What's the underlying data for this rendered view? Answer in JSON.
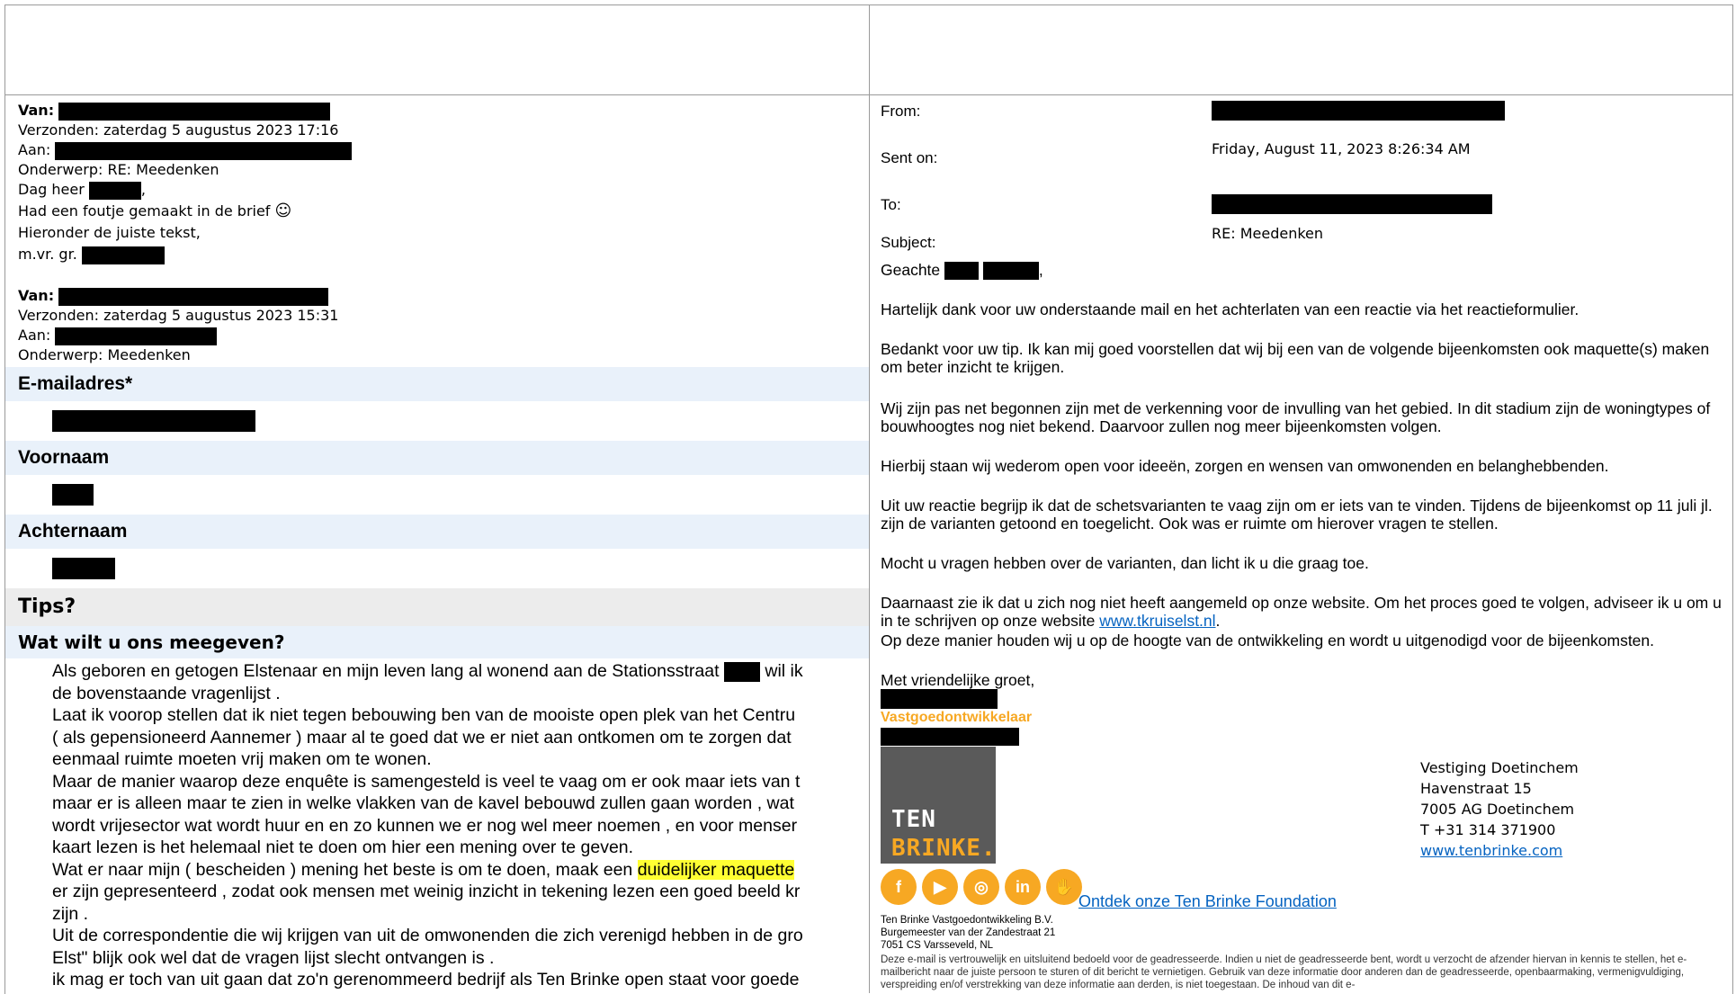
{
  "left": {
    "mail1": {
      "van_label": "Van:",
      "verzonden": "Verzonden: zaterdag 5 augustus 2023 17:16",
      "aan_label": "Aan:",
      "onderwerp": "Onderwerp: RE: Meedenken",
      "greeting": "Dag heer",
      "line1": "Had een foutje gemaakt in de brief",
      "line2": "Hieronder de juiste tekst,",
      "closing": "m.vr. gr."
    },
    "mail2": {
      "van_label": "Van:",
      "verzonden": "Verzonden: zaterdag 5 augustus 2023 15:31",
      "aan_label": "Aan:",
      "onderwerp": "Onderwerp: Meedenken"
    },
    "form": {
      "email_label": "E-mailadres*",
      "firstname_label": "Voornaam",
      "lastname_label": "Achternaam",
      "tips_label": "Tips?",
      "question_label": "Wat wilt u ons meegeven?"
    },
    "comment": {
      "l1a": "Als geboren en getogen Elstenaar en mijn leven lang al wonend aan de Stationsstraat",
      "l1b": "wil ik",
      "l2": "de bovenstaande vragenlijst .",
      "l3": "Laat ik voorop stellen dat ik niet tegen bebouwing ben van de mooiste open plek van het Centru",
      "l4": "( als gepensioneerd Aannemer ) maar al te goed dat we er niet aan ontkomen om te zorgen dat",
      "l5": "eenmaal ruimte moeten vrij maken om te wonen.",
      "l6": "Maar de manier waarop deze enquête is samengesteld is veel te vaag om er ook maar iets van t",
      "l7": "maar er is alleen maar te zien in welke vlakken van de kavel bebouwd zullen gaan worden , wat",
      "l8": "wordt vrijesector wat wordt huur en en zo kunnen we er nog wel meer noemen , en voor menser",
      "l9": "kaart lezen is het helemaal niet te doen om hier een mening over te geven.",
      "l10a": "Wat er naar mijn ( bescheiden ) mening het beste is om te doen, maak een",
      "l10b": "duidelijker maquette",
      "l11": "er zijn gepresenteerd , zodat ook mensen met weinig inzicht in tekening lezen een goed beeld kr",
      "l12": "zijn .",
      "l13": "Uit de correspondentie die wij krijgen van uit de omwonenden die zich verenigd hebben in de gro",
      "l14": "Elst\" blijk ook wel dat de vragen lijst slecht ontvangen is .",
      "l15": "ik mag er toch van uit gaan dat zo'n gerenommeerd bedrijf als Ten Brinke open staat voor goede"
    }
  },
  "right": {
    "from_label": "From:",
    "sent_label": "Sent on:",
    "sent_value": "Friday, August 11, 2023 8:26:34 AM",
    "to_label": "To:",
    "subject_label": "Subject:",
    "subject_value": "RE: Meedenken",
    "salutation": "Geachte",
    "p1": "Hartelijk dank voor uw onderstaande mail en het achterlaten van een reactie via het reactieformulier.",
    "p2": "Bedankt voor uw tip. Ik kan mij goed voorstellen dat wij bij een van de volgende bijeenkomsten ook maquette(s) maken om beter inzicht te krijgen.",
    "p3": "Wij zijn pas net begonnen zijn met de verkenning voor de invulling van het gebied. In dit stadium zijn de woningtypes of bouwhoogtes nog niet bekend. Daarvoor zullen nog meer bijeenkomsten volgen.",
    "p4": "Hierbij staan wij wederom open voor ideeën, zorgen en wensen van omwonenden en belanghebbenden.",
    "p5": "Uit uw reactie begrijp ik dat de schetsvarianten te vaag zijn om er iets van te vinden. Tijdens de bijeenkomst op 11 juli jl. zijn de varianten getoond en toegelicht. Ook was er ruimte om hierover vragen te stellen.",
    "p6": "Mocht u vragen hebben over de varianten, dan licht ik u die graag toe.",
    "p7a": "Daarnaast zie ik dat u zich nog niet heeft aangemeld op onze website. Om het proces goed te volgen, adviseer ik u om u in te schrijven op onze website",
    "p7_link": "www.tkruiselst.nl",
    "p7b": ".",
    "p8": "Op deze manier houden wij u op de hoogte van de ontwikkeling en wordt u uitgenodigd voor de bijeenkomsten.",
    "regards": "Met vriendelijke groet,",
    "role": "Vastgoedontwikkelaar",
    "logo_line1": "TEN",
    "logo_line2": "BRINKE.",
    "address": {
      "l1": "Vestiging Doetinchem",
      "l2": "Havenstraat 15",
      "l3": "7005 AG Doetinchem",
      "l4": "T +31 314 371900",
      "web": "www.tenbrinke.com"
    },
    "social": {
      "fb": "f",
      "yt": "▶",
      "ig": "◎",
      "li": "in",
      "fd": "✋"
    },
    "foundation": "Ontdek onze Ten Brinke Foundation",
    "company": {
      "l1": "Ten Brinke Vastgoedontwikkeling B.V.",
      "l2": "Burgemeester van der Zandestraat 21",
      "l3": "7051 CS Varsseveld, NL"
    },
    "disclaimer": "Deze e-mail is vertrouwelijk en uitsluitend bedoeld voor de geadresseerde. Indien u niet de geadresseerde bent, wordt u verzocht de afzender hiervan in kennis te stellen, het e-mailbericht naar de juiste persoon te sturen of dit bericht te vernietigen. Gebruik van deze informatie door anderen dan de geadresseerde, openbaarmaking, vermenigvuldiging, verspreiding en/of verstrekking van deze informatie aan derden, is niet toegestaan. De inhoud van dit e-"
  }
}
